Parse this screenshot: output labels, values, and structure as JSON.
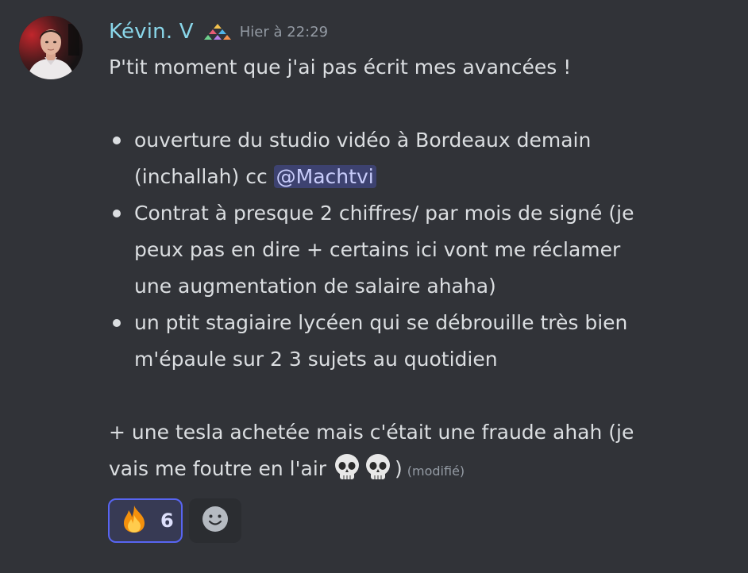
{
  "author": {
    "name": "Kévin. V",
    "name_color": "#8ad7ea",
    "badge_icon": "guild-tag-icon",
    "timestamp": "Hier à 22:29"
  },
  "message": {
    "intro": "P'tit moment que j'ai pas écrit mes avancées !",
    "bullets": {
      "b1_line1": "ouverture du studio vidéo à Bordeaux demain",
      "b1_line2": "(inchallah) cc",
      "b1_mention": "@Machtvi",
      "b2_line1": "Contrat à presque 2 chiffres/ par mois de signé (je",
      "b2_line2": "peux pas en dire + certains ici vont me réclamer",
      "b2_line3": "une augmentation de salaire ahaha)",
      "b3_line1": "un ptit stagiaire lycéen qui se débrouille très bien",
      "b3_line2": "m'épaule sur 2 3 sujets au quotidien"
    },
    "outro_line1": "+ une tesla achetée mais c'était une fraude ahah (je",
    "outro_line2": "vais me foutre en l'air",
    "outro_emojis": [
      "skull-emoji",
      "skull-emoji"
    ],
    "outro_close": ")",
    "edited_label": "(modifié)"
  },
  "reactions": [
    {
      "emoji": "fire-emoji",
      "count": "6",
      "active": true,
      "accent": "#5865f2"
    }
  ],
  "add_reaction_icon": "smiley-icon",
  "colors": {
    "background": "#313338",
    "text": "#dbdee1",
    "muted": "#949ba4",
    "mention_bg": "#3d4270",
    "mention_text": "#c9cdfb"
  }
}
